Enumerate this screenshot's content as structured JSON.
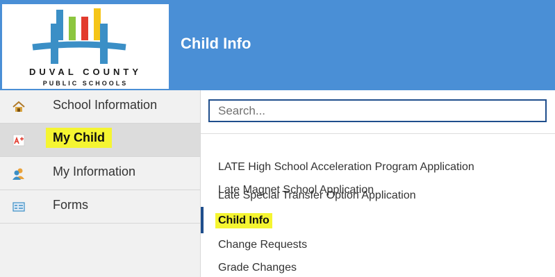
{
  "header": {
    "logo": {
      "line1": "DUVAL COUNTY",
      "line2": "PUBLIC SCHOOLS",
      "colors": {
        "blue": "#3b8fc6",
        "red": "#e23b2e",
        "yellow": "#f5c518",
        "green": "#8cc63f"
      }
    },
    "title": "Child Info",
    "background": "#4a8fd6"
  },
  "sidebar": {
    "items": [
      {
        "label": "School Information",
        "icon": "house-icon",
        "active": false
      },
      {
        "label": "My Child",
        "icon": "report-icon",
        "active": true,
        "highlighted": true
      },
      {
        "label": "My Information",
        "icon": "people-icon",
        "active": false
      },
      {
        "label": "Forms",
        "icon": "form-icon",
        "active": false
      }
    ]
  },
  "search": {
    "placeholder": "Search..."
  },
  "menu": {
    "items": [
      {
        "label": "LATE High School Acceleration Program Application"
      },
      {
        "label": "Late Magnet School Application"
      },
      {
        "label": "Late Special Transfer Option Application"
      },
      {
        "label": "Child Info",
        "selected": true,
        "highlighted": true
      },
      {
        "label": "Change Requests"
      },
      {
        "label": "Grade Changes"
      }
    ]
  },
  "colors": {
    "highlight": "#f5f531",
    "accent": "#1f4e8c"
  }
}
